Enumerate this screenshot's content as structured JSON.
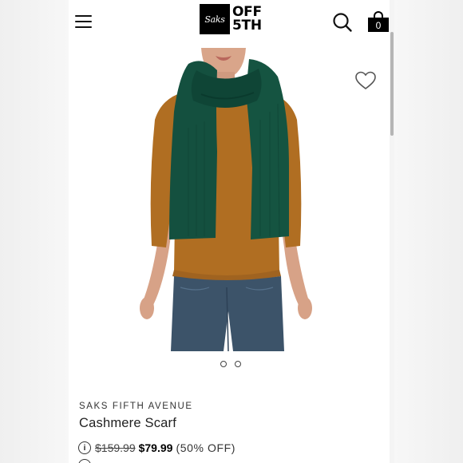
{
  "header": {
    "logo": {
      "box_text": "Saks",
      "line1": "OFF",
      "line2": "5TH"
    },
    "icons": {
      "menu": "hamburger-menu-icon",
      "search": "search-icon",
      "bag": "shopping-bag-icon",
      "wishlist": "heart-icon",
      "info": "info-icon"
    },
    "bag_count": "0"
  },
  "carousel": {
    "image": "model wearing green cashmere scarf",
    "total_slides": 2
  },
  "product": {
    "brand": "SAKS FIFTH AVENUE",
    "name": "Cashmere Scarf",
    "original_price": "$159.99",
    "sale_price": "$79.99",
    "discount": "(50% OFF)",
    "info_glyph": "i"
  },
  "colors": {
    "scarf": "#14503f",
    "sweater": "#b06e22",
    "jeans": "#3c5369",
    "accent": "#000000"
  }
}
